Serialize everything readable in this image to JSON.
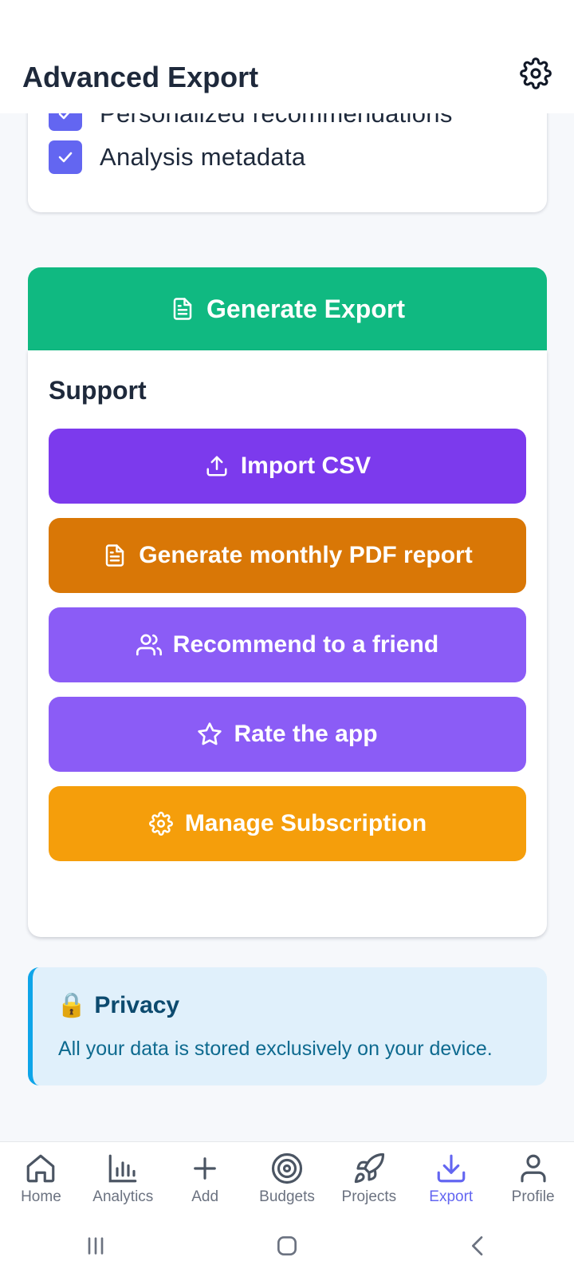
{
  "header": {
    "title": "Advanced Export",
    "settings_icon": "gear-icon"
  },
  "options": {
    "items": [
      {
        "label": "Personalized recommendations",
        "checked": true
      },
      {
        "label": "Analysis metadata",
        "checked": true
      }
    ]
  },
  "generate": {
    "label": "Generate Export",
    "icon": "document-icon",
    "color": "#10b981"
  },
  "support": {
    "title": "Support",
    "buttons": [
      {
        "label": "Import CSV",
        "icon": "upload-icon",
        "color": "#7c3aed"
      },
      {
        "label": "Generate monthly PDF report",
        "icon": "document-icon",
        "color": "#d97706"
      },
      {
        "label": "Recommend to a friend",
        "icon": "users-icon",
        "color": "#8b5cf6"
      },
      {
        "label": "Rate the app",
        "icon": "star-icon",
        "color": "#8b5cf6"
      },
      {
        "label": "Manage Subscription",
        "icon": "gear-icon",
        "color": "#f59e0b"
      }
    ]
  },
  "privacy": {
    "emoji": "🔒",
    "title": "Privacy",
    "text": "All your data is stored exclusively on your device."
  },
  "nav": {
    "active": "Export",
    "items": [
      {
        "label": "Home",
        "icon": "home-icon"
      },
      {
        "label": "Analytics",
        "icon": "bar-chart-icon"
      },
      {
        "label": "Add",
        "icon": "plus-icon"
      },
      {
        "label": "Budgets",
        "icon": "target-icon"
      },
      {
        "label": "Projects",
        "icon": "rocket-icon"
      },
      {
        "label": "Export",
        "icon": "download-icon"
      },
      {
        "label": "Profile",
        "icon": "user-icon"
      }
    ]
  },
  "system_bar": {
    "buttons": [
      "recents-icon",
      "home-button-icon",
      "back-icon"
    ]
  },
  "colors": {
    "accent": "#6366f1",
    "background": "#f6f8fb"
  }
}
